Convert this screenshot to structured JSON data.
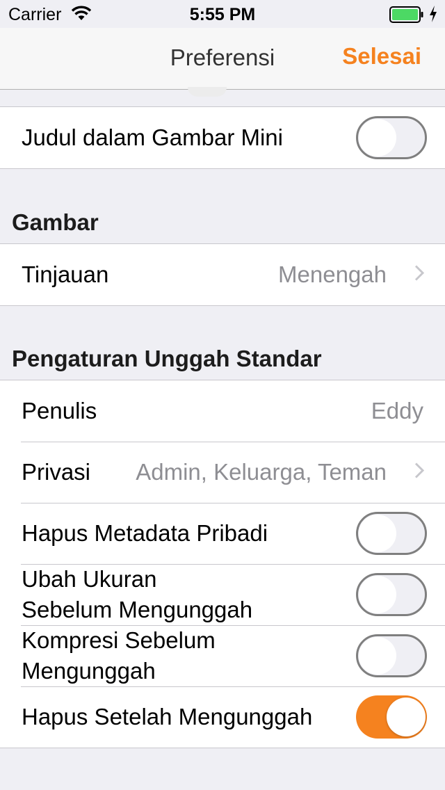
{
  "status_bar": {
    "carrier": "Carrier",
    "time": "5:55 PM",
    "battery_color": "#4cd964"
  },
  "nav": {
    "title": "Preferensi",
    "done_label": "Selesai",
    "accent_color": "#f5821f"
  },
  "top_group": {
    "row": {
      "label": "Judul dalam Gambar Mini",
      "on": false
    }
  },
  "images_section": {
    "header": "Gambar",
    "rows": [
      {
        "label": "Tinjauan",
        "value": "Menengah"
      }
    ]
  },
  "upload_section": {
    "header": "Pengaturan Unggah Standar",
    "author": {
      "label": "Penulis",
      "value": "Eddy"
    },
    "privacy": {
      "label": "Privasi",
      "value": "Admin, Keluarga, Teman"
    },
    "strip_metadata": {
      "label": "Hapus Metadata Pribadi",
      "on": false
    },
    "resize": {
      "label_line1": "Ubah Ukuran",
      "label_line2": "Sebelum Mengunggah",
      "on": false
    },
    "compress": {
      "label_line1": "Kompresi Sebelum",
      "label_line2": "Mengunggah",
      "on": false
    },
    "delete_after": {
      "label": "Hapus Setelah Mengunggah",
      "on": true
    }
  }
}
